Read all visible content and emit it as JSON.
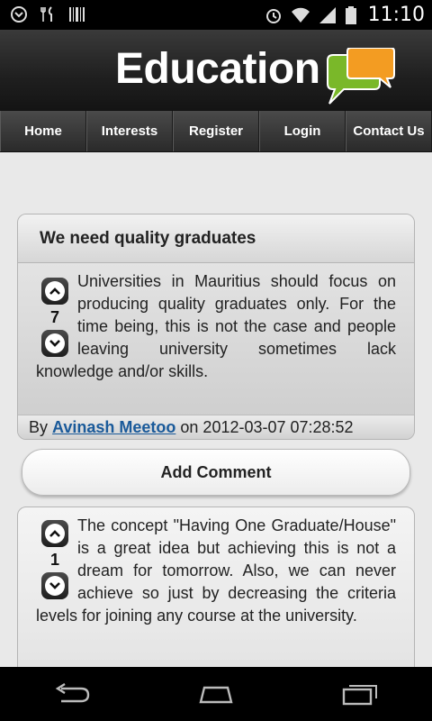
{
  "status_bar": {
    "time": "11:10",
    "icons": [
      "usb-debug-icon",
      "restaurant-icon",
      "barcode-icon",
      "alarm-icon",
      "wifi-icon",
      "signal-icon",
      "battery-icon"
    ]
  },
  "header": {
    "title": "Education",
    "logo_colors": {
      "green": "#7ab829",
      "orange": "#f39c22"
    }
  },
  "nav": {
    "tabs": [
      "Home",
      "Interests",
      "Register",
      "Login",
      "Contact Us"
    ]
  },
  "post": {
    "title": "We need quality graduates",
    "votes": "7",
    "body": "Universities in Mauritius should focus on producing quality graduates only. For the time being, this is not the case and people leaving university sometimes lack knowledge and/or skills.",
    "footer": {
      "by": "By",
      "author": "Avinash Meetoo",
      "on": "on 2012-03-07 07:28:52"
    }
  },
  "add_comment": {
    "label": "Add Comment"
  },
  "comment": {
    "votes": "1",
    "body": "The concept \"Having One Graduate/House\" is a great idea but achieving this is not a dream for tomorrow. Also, we can never achieve so just by decreasing the criteria levels for joining any course at the university."
  },
  "system_nav": {
    "buttons": [
      "back-icon",
      "home-icon",
      "recent-apps-icon"
    ]
  }
}
